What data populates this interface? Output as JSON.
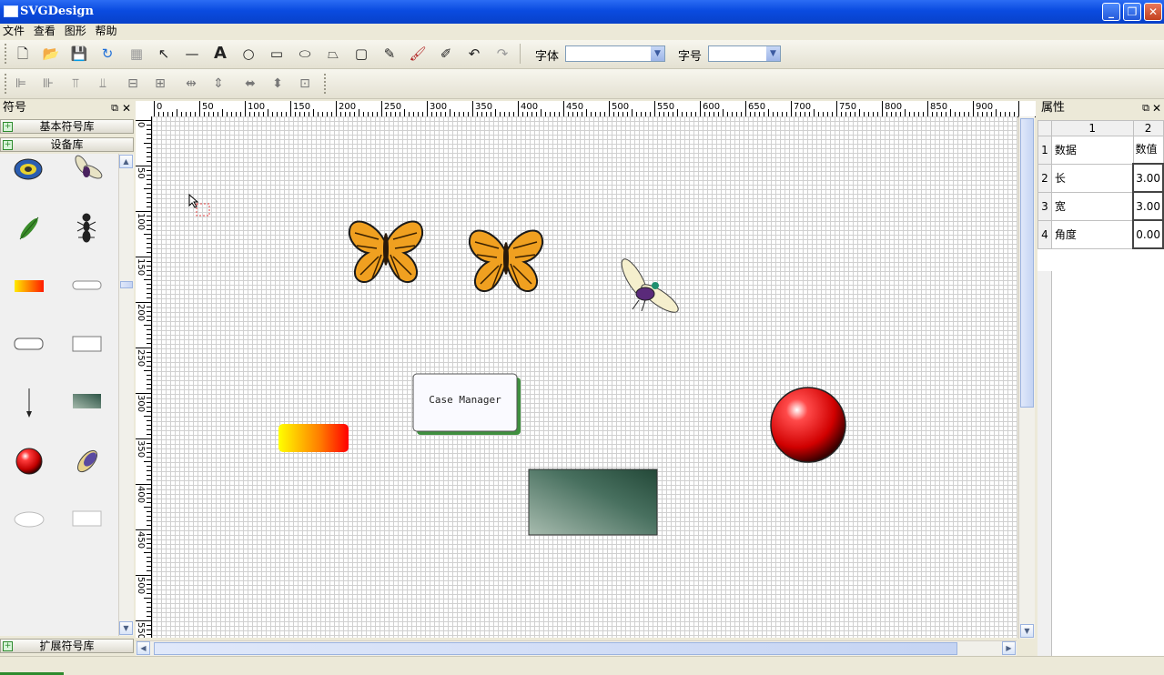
{
  "window": {
    "title": "SVGDesign",
    "min_label": "_",
    "max_label": "❐",
    "close_label": "✕"
  },
  "menu": [
    "文件",
    "查看",
    "图形",
    "帮助"
  ],
  "toolbar": {
    "font_label": "字体",
    "font_value": "",
    "size_label": "字号",
    "size_value": ""
  },
  "symbols_panel": {
    "title": "符号",
    "libraries": [
      "基本符号库",
      "设备库"
    ],
    "extend_library": "扩展符号库",
    "items": [
      "globe-device",
      "fly",
      "leaf",
      "ant",
      "gradient-rect",
      "small-button",
      "rounded-button",
      "case-manager-box",
      "arrow-down",
      "green-rect",
      "red-ball",
      "color-brush",
      "ellipse",
      "rectangle"
    ]
  },
  "ruler": {
    "h_ticks": [
      "0",
      "50",
      "100",
      "150",
      "200",
      "250",
      "300",
      "350",
      "400",
      "450",
      "500",
      "550",
      "600",
      "650",
      "700",
      "750",
      "800",
      "850",
      "900"
    ],
    "v_ticks": [
      "0",
      "50",
      "100",
      "150",
      "200",
      "250",
      "300",
      "350",
      "400",
      "450",
      "500",
      "550"
    ]
  },
  "canvas": {
    "case_manager_text": "Case Manager"
  },
  "properties_panel": {
    "title": "属性",
    "col_headers": [
      "1",
      "2"
    ],
    "rows": [
      {
        "num": "1",
        "name": "数据",
        "value": "数值"
      },
      {
        "num": "2",
        "name": "长",
        "value": "3.00"
      },
      {
        "num": "3",
        "name": "宽",
        "value": "3.00"
      },
      {
        "num": "4",
        "name": "角度",
        "value": "0.00"
      }
    ]
  },
  "colors": {
    "title_bar": "#0a4be0",
    "accent_green": "#2e8b2e",
    "ball_red": "#cc0000"
  }
}
